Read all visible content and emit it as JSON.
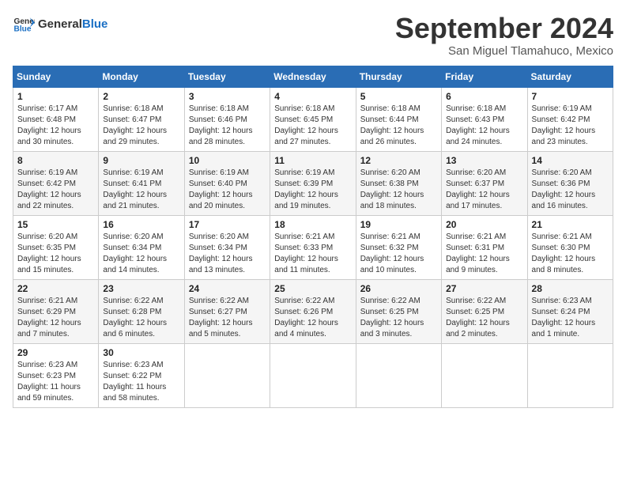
{
  "header": {
    "logo_general": "General",
    "logo_blue": "Blue",
    "month": "September 2024",
    "location": "San Miguel Tlamahuco, Mexico"
  },
  "days_of_week": [
    "Sunday",
    "Monday",
    "Tuesday",
    "Wednesday",
    "Thursday",
    "Friday",
    "Saturday"
  ],
  "weeks": [
    [
      {
        "day": "1",
        "sunrise": "6:17 AM",
        "sunset": "6:48 PM",
        "daylight": "12 hours and 30 minutes."
      },
      {
        "day": "2",
        "sunrise": "6:18 AM",
        "sunset": "6:47 PM",
        "daylight": "12 hours and 29 minutes."
      },
      {
        "day": "3",
        "sunrise": "6:18 AM",
        "sunset": "6:46 PM",
        "daylight": "12 hours and 28 minutes."
      },
      {
        "day": "4",
        "sunrise": "6:18 AM",
        "sunset": "6:45 PM",
        "daylight": "12 hours and 27 minutes."
      },
      {
        "day": "5",
        "sunrise": "6:18 AM",
        "sunset": "6:44 PM",
        "daylight": "12 hours and 26 minutes."
      },
      {
        "day": "6",
        "sunrise": "6:18 AM",
        "sunset": "6:43 PM",
        "daylight": "12 hours and 24 minutes."
      },
      {
        "day": "7",
        "sunrise": "6:19 AM",
        "sunset": "6:42 PM",
        "daylight": "12 hours and 23 minutes."
      }
    ],
    [
      {
        "day": "8",
        "sunrise": "6:19 AM",
        "sunset": "6:42 PM",
        "daylight": "12 hours and 22 minutes."
      },
      {
        "day": "9",
        "sunrise": "6:19 AM",
        "sunset": "6:41 PM",
        "daylight": "12 hours and 21 minutes."
      },
      {
        "day": "10",
        "sunrise": "6:19 AM",
        "sunset": "6:40 PM",
        "daylight": "12 hours and 20 minutes."
      },
      {
        "day": "11",
        "sunrise": "6:19 AM",
        "sunset": "6:39 PM",
        "daylight": "12 hours and 19 minutes."
      },
      {
        "day": "12",
        "sunrise": "6:20 AM",
        "sunset": "6:38 PM",
        "daylight": "12 hours and 18 minutes."
      },
      {
        "day": "13",
        "sunrise": "6:20 AM",
        "sunset": "6:37 PM",
        "daylight": "12 hours and 17 minutes."
      },
      {
        "day": "14",
        "sunrise": "6:20 AM",
        "sunset": "6:36 PM",
        "daylight": "12 hours and 16 minutes."
      }
    ],
    [
      {
        "day": "15",
        "sunrise": "6:20 AM",
        "sunset": "6:35 PM",
        "daylight": "12 hours and 15 minutes."
      },
      {
        "day": "16",
        "sunrise": "6:20 AM",
        "sunset": "6:34 PM",
        "daylight": "12 hours and 14 minutes."
      },
      {
        "day": "17",
        "sunrise": "6:20 AM",
        "sunset": "6:34 PM",
        "daylight": "12 hours and 13 minutes."
      },
      {
        "day": "18",
        "sunrise": "6:21 AM",
        "sunset": "6:33 PM",
        "daylight": "12 hours and 11 minutes."
      },
      {
        "day": "19",
        "sunrise": "6:21 AM",
        "sunset": "6:32 PM",
        "daylight": "12 hours and 10 minutes."
      },
      {
        "day": "20",
        "sunrise": "6:21 AM",
        "sunset": "6:31 PM",
        "daylight": "12 hours and 9 minutes."
      },
      {
        "day": "21",
        "sunrise": "6:21 AM",
        "sunset": "6:30 PM",
        "daylight": "12 hours and 8 minutes."
      }
    ],
    [
      {
        "day": "22",
        "sunrise": "6:21 AM",
        "sunset": "6:29 PM",
        "daylight": "12 hours and 7 minutes."
      },
      {
        "day": "23",
        "sunrise": "6:22 AM",
        "sunset": "6:28 PM",
        "daylight": "12 hours and 6 minutes."
      },
      {
        "day": "24",
        "sunrise": "6:22 AM",
        "sunset": "6:27 PM",
        "daylight": "12 hours and 5 minutes."
      },
      {
        "day": "25",
        "sunrise": "6:22 AM",
        "sunset": "6:26 PM",
        "daylight": "12 hours and 4 minutes."
      },
      {
        "day": "26",
        "sunrise": "6:22 AM",
        "sunset": "6:25 PM",
        "daylight": "12 hours and 3 minutes."
      },
      {
        "day": "27",
        "sunrise": "6:22 AM",
        "sunset": "6:25 PM",
        "daylight": "12 hours and 2 minutes."
      },
      {
        "day": "28",
        "sunrise": "6:23 AM",
        "sunset": "6:24 PM",
        "daylight": "12 hours and 1 minute."
      }
    ],
    [
      {
        "day": "29",
        "sunrise": "6:23 AM",
        "sunset": "6:23 PM",
        "daylight": "11 hours and 59 minutes."
      },
      {
        "day": "30",
        "sunrise": "6:23 AM",
        "sunset": "6:22 PM",
        "daylight": "11 hours and 58 minutes."
      },
      null,
      null,
      null,
      null,
      null
    ]
  ]
}
